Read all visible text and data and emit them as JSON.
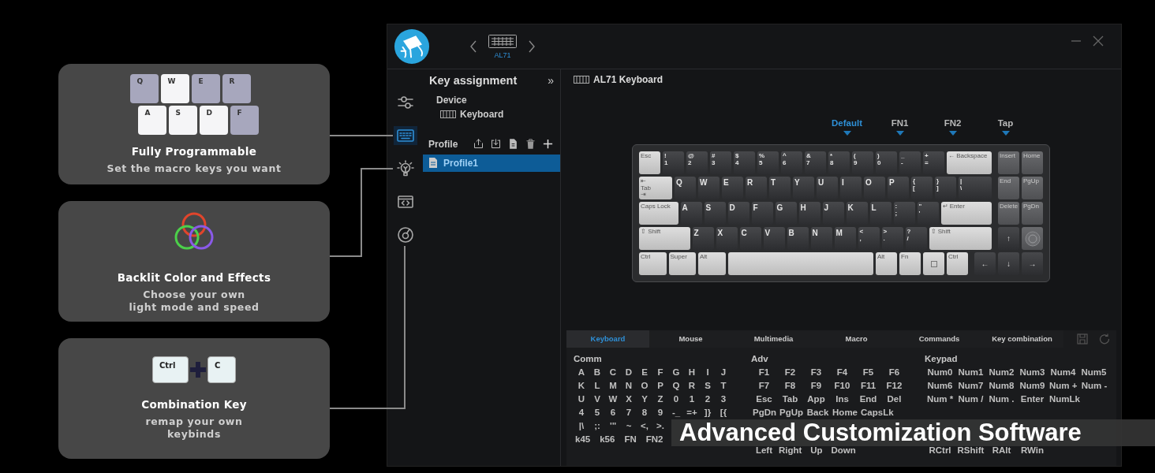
{
  "features": [
    {
      "kind": "keycaps",
      "keys": [
        {
          "label": "Q",
          "highlighted": false
        },
        {
          "label": "W",
          "highlighted": true
        },
        {
          "label": "E",
          "highlighted": false
        },
        {
          "label": "R",
          "highlighted": false
        },
        {
          "label": "A",
          "highlighted": true
        },
        {
          "label": "S",
          "highlighted": true
        },
        {
          "label": "D",
          "highlighted": true
        },
        {
          "label": "F",
          "highlighted": false
        }
      ],
      "title": "Fully Programmable",
      "subtitle": "Set the macro keys you want"
    },
    {
      "kind": "rgb",
      "title": "Backlit Color and Effects",
      "subtitle": "Choose your own\nlight mode and speed"
    },
    {
      "kind": "combo",
      "keys": [
        {
          "label": "Ctrl",
          "highlighted": true
        },
        {
          "label": "C",
          "highlighted": true
        }
      ],
      "title": "Combination Key",
      "subtitle": "remap your own\nkeybinds"
    }
  ],
  "app": {
    "device": {
      "label": "AL71"
    },
    "sidebar": {
      "items": [
        {
          "kind": "sliders",
          "selected": false
        },
        {
          "kind": "keyboard",
          "selected": true
        },
        {
          "kind": "bulb",
          "selected": false
        },
        {
          "kind": "code",
          "selected": false
        },
        {
          "kind": "disc",
          "selected": false
        }
      ]
    },
    "panel": {
      "title": "Key assignment",
      "collapse": "»",
      "device_heading": "Device",
      "device_name": "Keyboard",
      "profile_heading": "Profile",
      "profiles": [
        {
          "name": "Profile1",
          "selected": true
        }
      ]
    },
    "main": {
      "title": "AL71 Keyboard",
      "layers": [
        {
          "label": "Default",
          "selected": true
        },
        {
          "label": "FN1",
          "selected": false
        },
        {
          "label": "FN2",
          "selected": false
        },
        {
          "label": "Tap",
          "selected": false
        }
      ],
      "keyboard": {
        "rows": [
          {
            "main": [
              {
                "kind": "mod",
                "legends": [
                  "Esc"
                ]
              },
              {
                "kind": "alpha",
                "legends": [
                  "!",
                  "1"
                ]
              },
              {
                "kind": "alpha",
                "legends": [
                  "@",
                  "2"
                ]
              },
              {
                "kind": "alpha",
                "legends": [
                  "#",
                  "3"
                ]
              },
              {
                "kind": "alpha",
                "legends": [
                  "$",
                  "4"
                ]
              },
              {
                "kind": "alpha",
                "legends": [
                  "%",
                  "5"
                ]
              },
              {
                "kind": "alpha",
                "legends": [
                  "^",
                  "6"
                ]
              },
              {
                "kind": "alpha",
                "legends": [
                  "&",
                  "7"
                ]
              },
              {
                "kind": "alpha",
                "legends": [
                  "*",
                  "8"
                ]
              },
              {
                "kind": "alpha",
                "legends": [
                  "(",
                  "9"
                ]
              },
              {
                "kind": "alpha",
                "legends": [
                  ")",
                  "0"
                ]
              },
              {
                "kind": "alpha",
                "legends": [
                  "_",
                  "-"
                ]
              },
              {
                "kind": "alpha",
                "legends": [
                  "+",
                  "="
                ]
              },
              {
                "kind": "backspace",
                "legends": [
                  "← Backspace"
                ]
              }
            ],
            "nav": [
              {
                "kind": "nav",
                "legends": [
                  "Insert"
                ]
              },
              {
                "kind": "nav",
                "legends": [
                  "Home"
                ]
              }
            ]
          },
          {
            "main": [
              {
                "kind": "tab",
                "legends": [
                  "⇤",
                  "Tab",
                  "⇥"
                ]
              },
              {
                "kind": "alpha",
                "legends": [
                  "Q"
                ]
              },
              {
                "kind": "alpha",
                "legends": [
                  "W"
                ]
              },
              {
                "kind": "alpha",
                "legends": [
                  "E"
                ]
              },
              {
                "kind": "alpha",
                "legends": [
                  "R"
                ]
              },
              {
                "kind": "alpha",
                "legends": [
                  "T"
                ]
              },
              {
                "kind": "alpha",
                "legends": [
                  "Y"
                ]
              },
              {
                "kind": "alpha",
                "legends": [
                  "U"
                ]
              },
              {
                "kind": "alpha",
                "legends": [
                  "I"
                ]
              },
              {
                "kind": "alpha",
                "legends": [
                  "O"
                ]
              },
              {
                "kind": "alpha",
                "legends": [
                  "P"
                ]
              },
              {
                "kind": "alpha",
                "legends": [
                  "{",
                  "["
                ]
              },
              {
                "kind": "alpha",
                "legends": [
                  "}",
                  "]"
                ]
              },
              {
                "kind": "wide",
                "legends": [
                  "|",
                  "\\"
                ]
              }
            ],
            "nav": [
              {
                "kind": "nav",
                "legends": [
                  "End"
                ]
              },
              {
                "kind": "nav",
                "legends": [
                  "PgUp"
                ]
              }
            ]
          },
          {
            "main": [
              {
                "kind": "caps",
                "legends": [
                  "Caps Lock"
                ]
              },
              {
                "kind": "alpha",
                "legends": [
                  "A"
                ]
              },
              {
                "kind": "alpha",
                "legends": [
                  "S"
                ]
              },
              {
                "kind": "alpha",
                "legends": [
                  "D"
                ]
              },
              {
                "kind": "alpha",
                "legends": [
                  "F"
                ]
              },
              {
                "kind": "alpha",
                "legends": [
                  "G"
                ]
              },
              {
                "kind": "alpha",
                "legends": [
                  "H"
                ]
              },
              {
                "kind": "alpha",
                "legends": [
                  "J"
                ]
              },
              {
                "kind": "alpha",
                "legends": [
                  "K"
                ]
              },
              {
                "kind": "alpha",
                "legends": [
                  "L"
                ]
              },
              {
                "kind": "alpha",
                "legends": [
                  ":",
                  ";"
                ]
              },
              {
                "kind": "alpha",
                "legends": [
                  "\"",
                  "'"
                ]
              },
              {
                "kind": "enter",
                "legends": [
                  "↵ Enter"
                ]
              }
            ],
            "nav": [
              {
                "kind": "nav",
                "legends": [
                  "Delete"
                ]
              },
              {
                "kind": "nav",
                "legends": [
                  "PgDn"
                ]
              }
            ]
          },
          {
            "main": [
              {
                "kind": "lshift",
                "legends": [
                  "⇧ Shift"
                ]
              },
              {
                "kind": "alpha",
                "legends": [
                  "Z"
                ]
              },
              {
                "kind": "alpha",
                "legends": [
                  "X"
                ]
              },
              {
                "kind": "alpha",
                "legends": [
                  "C"
                ]
              },
              {
                "kind": "alpha",
                "legends": [
                  "V"
                ]
              },
              {
                "kind": "alpha",
                "legends": [
                  "B"
                ]
              },
              {
                "kind": "alpha",
                "legends": [
                  "N"
                ]
              },
              {
                "kind": "alpha",
                "legends": [
                  "M"
                ]
              },
              {
                "kind": "alpha",
                "legends": [
                  "<",
                  ","
                ]
              },
              {
                "kind": "alpha",
                "legends": [
                  ">",
                  "."
                ]
              },
              {
                "kind": "alpha",
                "legends": [
                  "?",
                  "/"
                ]
              },
              {
                "kind": "rshift",
                "legends": [
                  "⇧ Shift"
                ]
              }
            ],
            "nav": [
              {
                "kind": "arrow",
                "legends": [
                  "↑"
                ]
              },
              {
                "kind": "knob"
              }
            ]
          },
          {
            "main": [
              {
                "kind": "bmod",
                "legends": [
                  "Ctrl"
                ]
              },
              {
                "kind": "bmod",
                "legends": [
                  "Super"
                ]
              },
              {
                "kind": "bmod",
                "legends": [
                  "Alt"
                ]
              },
              {
                "kind": "space"
              },
              {
                "kind": "mod",
                "legends": [
                  "Alt"
                ]
              },
              {
                "kind": "mod",
                "legends": [
                  "Fn"
                ]
              },
              {
                "kind": "menu"
              },
              {
                "kind": "mod",
                "legends": [
                  "Ctrl"
                ]
              }
            ],
            "nav": [
              {
                "kind": "arrow",
                "legends": [
                  "←"
                ]
              },
              {
                "kind": "arrow",
                "legends": [
                  "↓"
                ]
              },
              {
                "kind": "arrow",
                "legends": [
                  "→"
                ]
              }
            ]
          }
        ]
      },
      "palette": {
        "tabs": [
          {
            "label": "Keyboard",
            "selected": true
          },
          {
            "label": "Mouse",
            "selected": false
          },
          {
            "label": "Multimedia",
            "selected": false
          },
          {
            "label": "Macro",
            "selected": false
          },
          {
            "label": "Commands",
            "selected": false
          },
          {
            "label": "Key combination",
            "selected": false
          }
        ],
        "columns": [
          {
            "kind": "comm",
            "heading": "Comm",
            "rows": [
              [
                "A",
                "B",
                "C",
                "D",
                "E",
                "F",
                "G",
                "H",
                "I",
                "J"
              ],
              [
                "K",
                "L",
                "M",
                "N",
                "O",
                "P",
                "Q",
                "R",
                "S",
                "T"
              ],
              [
                "U",
                "V",
                "W",
                "X",
                "Y",
                "Z",
                "0",
                "1",
                "2",
                "3"
              ],
              [
                "4",
                "5",
                "6",
                "7",
                "8",
                "9",
                "-_",
                "=+",
                "]}",
                "[{"
              ],
              [
                "|\\",
                ";:",
                "'\"",
                "~",
                "<,",
                ">."
              ]
            ],
            "extra": [
              "k45",
              "k56",
              "FN",
              "FN2"
            ]
          },
          {
            "kind": "adv",
            "heading": "Adv",
            "rows": [
              [
                "F1",
                "F2",
                "F3",
                "F4",
                "F5",
                "F6"
              ],
              [
                "F7",
                "F8",
                "F9",
                "F10",
                "F11",
                "F12"
              ],
              [
                "Esc",
                "Tab",
                "App",
                "Ins",
                "End",
                "Del"
              ],
              [
                "PgDn",
                "PgUp",
                "Back",
                "Home",
                "CapsLk"
              ],
              [
                "Left",
                "Right",
                "Up",
                "Down"
              ]
            ]
          },
          {
            "kind": "keypad",
            "heading": "Keypad",
            "rows": [
              [
                "Num0",
                "Num1",
                "Num2",
                "Num3",
                "Num4",
                "Num5"
              ],
              [
                "Num6",
                "Num7",
                "Num8",
                "Num9",
                "Num +",
                "Num -"
              ],
              [
                "Num *",
                "Num /",
                "Num .",
                "Enter",
                "NumLk"
              ],
              [
                "RCtrl",
                "RShift",
                "RAlt",
                "RWin"
              ]
            ]
          }
        ]
      }
    }
  },
  "banner": "Advanced Customization Software"
}
